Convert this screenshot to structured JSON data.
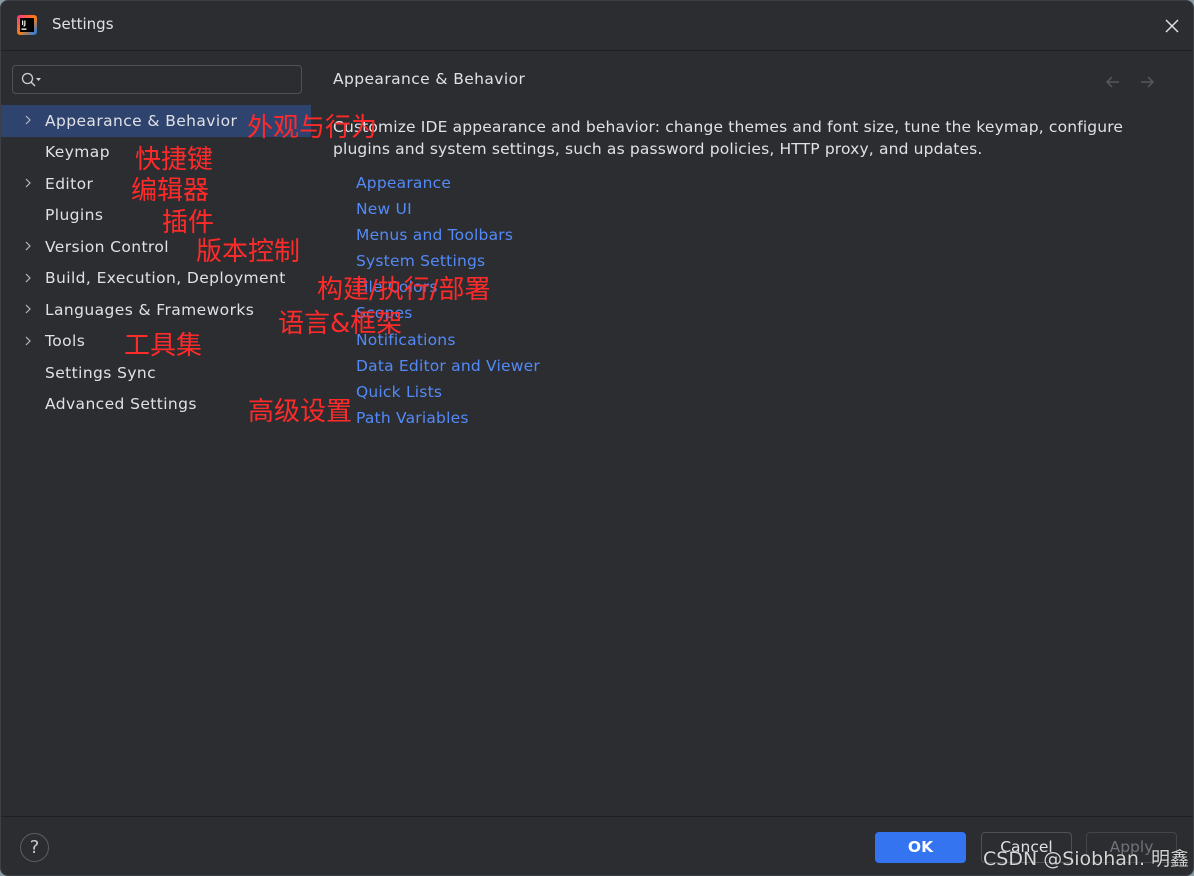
{
  "window": {
    "title": "Settings",
    "app_icon": "intellij-idea-icon"
  },
  "search": {
    "value": "",
    "placeholder": ""
  },
  "sidebar": {
    "items": [
      {
        "label": "Appearance & Behavior",
        "expandable": true,
        "selected": true,
        "annotation": "外观与行为"
      },
      {
        "label": "Keymap",
        "expandable": false,
        "selected": false,
        "annotation": "快捷键"
      },
      {
        "label": "Editor",
        "expandable": true,
        "selected": false,
        "annotation": "编辑器"
      },
      {
        "label": "Plugins",
        "expandable": false,
        "selected": false,
        "annotation": "插件"
      },
      {
        "label": "Version Control",
        "expandable": true,
        "selected": false,
        "annotation": "版本控制"
      },
      {
        "label": "Build, Execution, Deployment",
        "expandable": true,
        "selected": false,
        "annotation": "构建/执行/部署"
      },
      {
        "label": "Languages & Frameworks",
        "expandable": true,
        "selected": false,
        "annotation": "语言&框架"
      },
      {
        "label": "Tools",
        "expandable": true,
        "selected": false,
        "annotation": "工具集"
      },
      {
        "label": "Settings Sync",
        "expandable": false,
        "selected": false,
        "annotation": ""
      },
      {
        "label": "Advanced Settings",
        "expandable": false,
        "selected": false,
        "annotation": "高级设置"
      }
    ]
  },
  "content": {
    "title": "Appearance & Behavior",
    "description": "Customize IDE appearance and behavior: change themes and font size, tune the keymap, configure plugins and system settings, such as password policies, HTTP proxy, and updates.",
    "links": [
      "Appearance",
      "New UI",
      "Menus and Toolbars",
      "System Settings",
      "File Colors",
      "Scopes",
      "Notifications",
      "Data Editor and Viewer",
      "Quick Lists",
      "Path Variables"
    ]
  },
  "footer": {
    "help_label": "?",
    "ok_label": "OK",
    "cancel_label": "Cancel",
    "apply_label": "Apply"
  },
  "watermark": "CSDN @Siobhan. 明鑫",
  "colors": {
    "background": "#2b2d30",
    "selection": "#2e436e",
    "link": "#548af7",
    "primary_button": "#3574f0",
    "annotation": "#ff2a2a"
  }
}
